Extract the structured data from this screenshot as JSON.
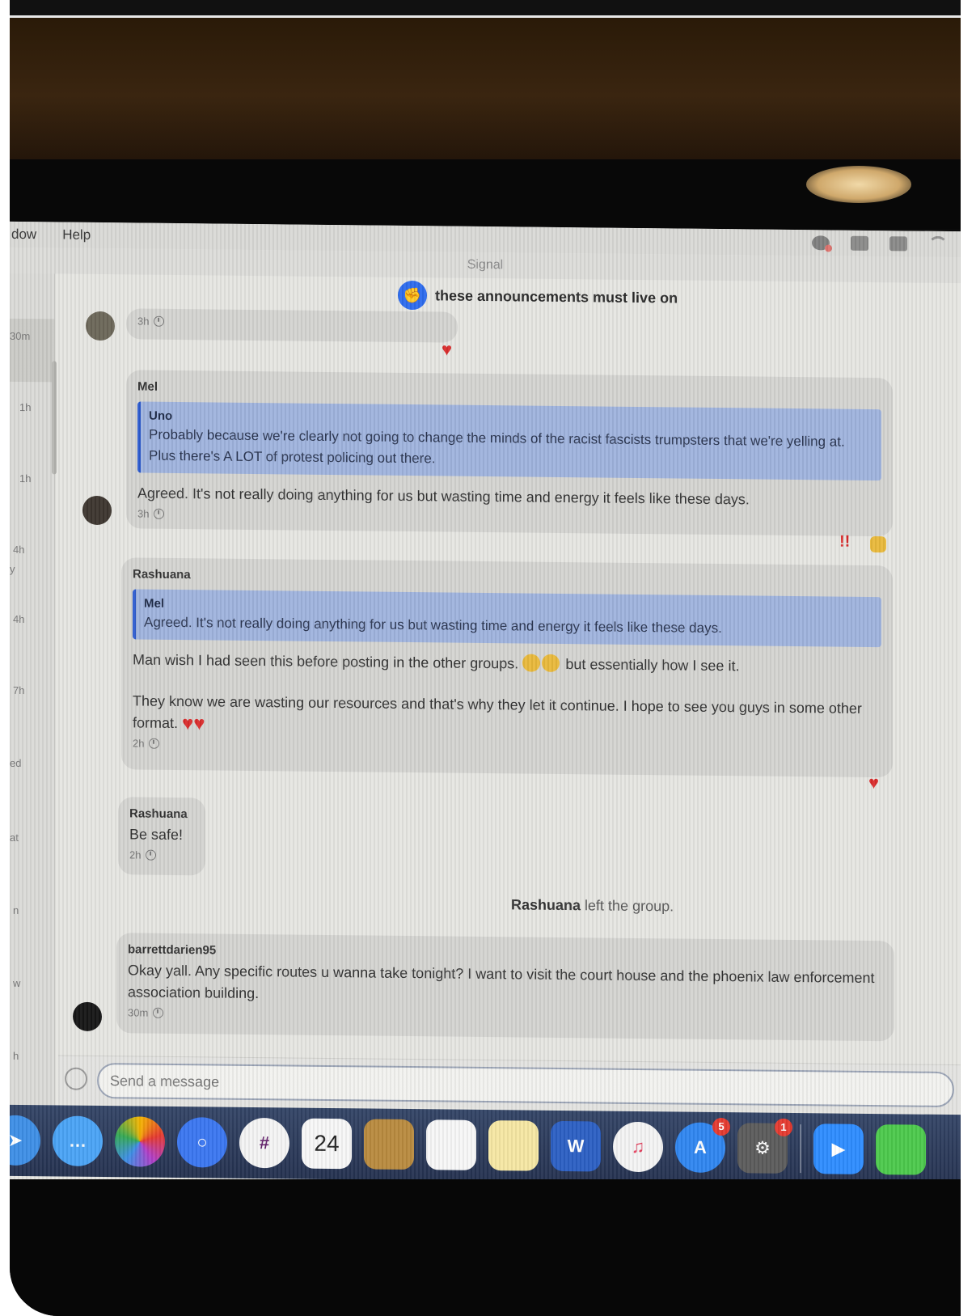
{
  "menubar": {
    "items": [
      "dow",
      "Help"
    ]
  },
  "window": {
    "title": "Signal"
  },
  "conversation": {
    "name": "these announcements must live on"
  },
  "sidebar": {
    "times": [
      "30m",
      "1h",
      "1h",
      "4h",
      "y",
      "4h",
      "7h",
      "ed",
      "at",
      "n",
      "w",
      "h"
    ]
  },
  "messages": {
    "first": {
      "time": "3h"
    },
    "mel": {
      "author": "Mel",
      "quote_author": "Uno",
      "quote_text": "Probably because we're clearly not going to change the minds of the racist fascists trumpsters that we're yelling at. Plus there's A LOT of protest policing out there.",
      "text": "Agreed. It's not really doing anything for us but wasting time and energy it feels like these days.",
      "time": "3h",
      "reaction_bang": "!!"
    },
    "rashuana1": {
      "author": "Rashuana",
      "quote_author": "Mel",
      "quote_text": "Agreed. It's not really doing anything for us but wasting time and energy it feels like these days.",
      "text1_a": "Man wish I had seen this before posting in the other groups.",
      "text1_b": "but essentially how I see it.",
      "text2": "They know we are wasting our resources and that's why they let it continue. I hope to see you guys in some other format.",
      "time": "2h"
    },
    "rashuana2": {
      "author": "Rashuana",
      "text": "Be safe!",
      "time": "2h"
    },
    "system": {
      "name": "Rashuana",
      "text": "left the group."
    },
    "barrett": {
      "author": "barrettdarien95",
      "text": "Okay yall. Any specific routes u wanna take tonight? I want to visit the court house and the phoenix law enforcement association building.",
      "time": "30m"
    }
  },
  "composer": {
    "placeholder": "Send a message"
  },
  "dock": {
    "calendar_day": "24",
    "word_letter": "W",
    "appstore_badge": "5",
    "settings_badge": "1"
  },
  "colors": {
    "accent": "#2c6bed",
    "quote_bg": "#9fb3dd",
    "heart": "#d92b2b"
  }
}
